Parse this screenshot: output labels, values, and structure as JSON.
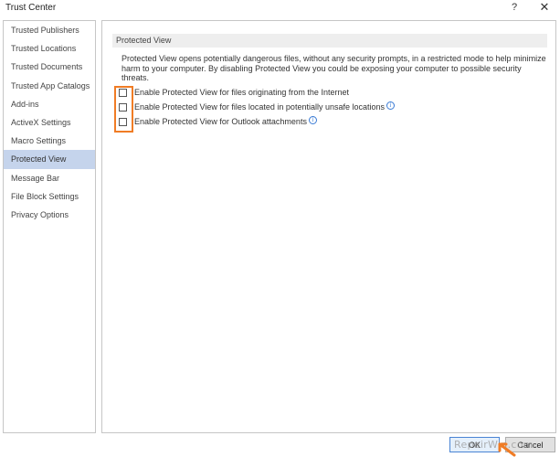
{
  "window": {
    "title": "Trust Center",
    "help_glyph": "?",
    "close_glyph": "✕"
  },
  "sidebar": {
    "items": [
      {
        "label": "Trusted Publishers"
      },
      {
        "label": "Trusted Locations"
      },
      {
        "label": "Trusted Documents"
      },
      {
        "label": "Trusted App Catalogs"
      },
      {
        "label": "Add-ins"
      },
      {
        "label": "ActiveX Settings"
      },
      {
        "label": "Macro Settings"
      },
      {
        "label": "Protected View",
        "selected": true
      },
      {
        "label": "Message Bar"
      },
      {
        "label": "File Block Settings"
      },
      {
        "label": "Privacy Options"
      }
    ]
  },
  "main": {
    "section_title": "Protected View",
    "description": "Protected View opens potentially dangerous files, without any security prompts, in a restricted mode to help minimize harm to your computer. By disabling Protected View you could be exposing your computer to possible security threats.",
    "options": [
      {
        "label": "Enable Protected View for files originating from the Internet",
        "checked": false,
        "info": false
      },
      {
        "label": "Enable Protected View for files located in potentially unsafe locations",
        "checked": false,
        "info": true
      },
      {
        "label": "Enable Protected View for Outlook attachments",
        "checked": false,
        "info": true
      }
    ],
    "info_glyph": "i"
  },
  "footer": {
    "ok_label": "OK",
    "cancel_label": "Cancel",
    "watermark": "RepairWin.com"
  },
  "colors": {
    "highlight": "#f07c25",
    "selected_nav": "#c5d4ec",
    "info": "#3a7bd5"
  }
}
